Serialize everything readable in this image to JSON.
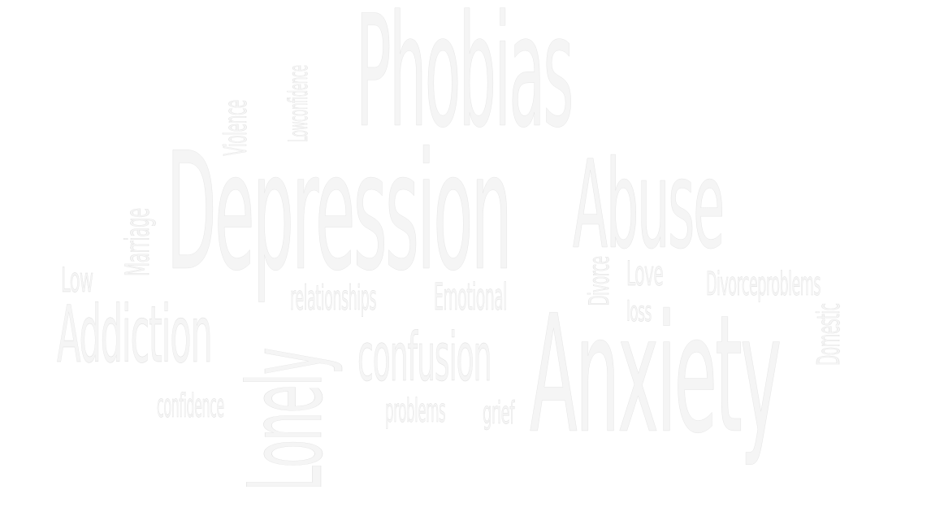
{
  "words": {
    "phobias": "Phobias",
    "depression": "Depression",
    "abuse": "Abuse",
    "anxiety": "Anxiety",
    "addiction": "Addiction",
    "confusion": "confusion",
    "relationships": "relationships",
    "emotional": "Emotional",
    "love": "Love",
    "loss": "loss",
    "divorceproblems": "Divorceproblems",
    "low": "Low",
    "confidence": "confidence",
    "problems": "problems",
    "grief": "grief",
    "violence": "Violence",
    "lowconfidence": "Lowconfidence",
    "marriage": "Marriage",
    "divorce": "Divorce",
    "domestic": "Domestic",
    "lonely": "Lonely"
  }
}
